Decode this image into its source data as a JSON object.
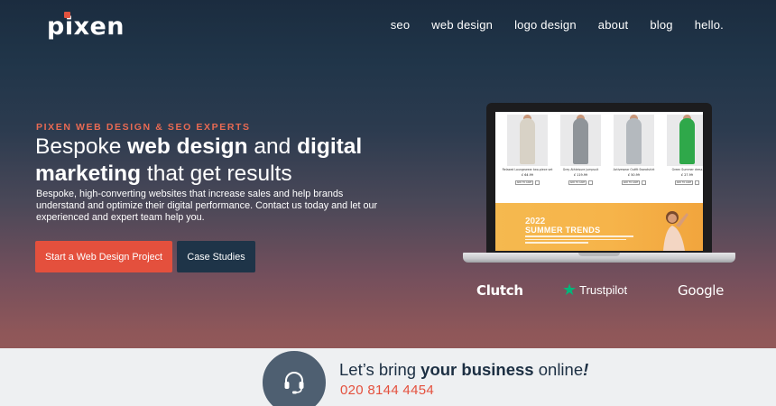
{
  "brand": {
    "name": "pixen",
    "accent": "#e4503d",
    "dark": "#1e3448"
  },
  "nav": {
    "items": [
      "seo",
      "web design",
      "logo design",
      "about",
      "blog",
      "hello."
    ]
  },
  "hero": {
    "eyebrow": "PIXEN WEB DESIGN & SEO EXPERTS",
    "headline": {
      "part1": "Bespoke ",
      "bold1": "web design",
      "part2": " and ",
      "bold2": "digital marketing",
      "part3": " that get results"
    },
    "subtext": "Bespoke, high-converting websites that increase sales and help brands understand and optimize their digital performance. Contact us today and let our experienced and expert team help you.",
    "primary_button": "Start a Web Design Project",
    "secondary_button": "Case Studies"
  },
  "laptop_screen": {
    "products": [
      {
        "name": "Relaxed Loungewear two-piece set",
        "price": "£ 64.99",
        "button": "ADD TO CART",
        "color": "#d8d2c6"
      },
      {
        "name": "Grey Athleisure jumpsuit",
        "price": "£ 119.99",
        "button": "ADD TO CART",
        "color": "#8f9499"
      },
      {
        "name": "Activewear Outfit Sweatshirt",
        "price": "£ 50.99",
        "button": "ADD TO CART",
        "color": "#b4b9be"
      },
      {
        "name": "Green Summer dress",
        "price": "£ 27.99",
        "button": "ADD TO CART",
        "color": "#2fa84a"
      }
    ],
    "banner": {
      "year": "2022",
      "title": "SUMMER TRENDS"
    }
  },
  "trust": {
    "clutch": "Clutch",
    "trustpilot": "Trustpilot",
    "google": "Google"
  },
  "cta": {
    "text_part1": "Let’s bring ",
    "text_bold": "your business",
    "text_part2": " online",
    "text_end": "!",
    "phone": "020 8144 4454"
  }
}
